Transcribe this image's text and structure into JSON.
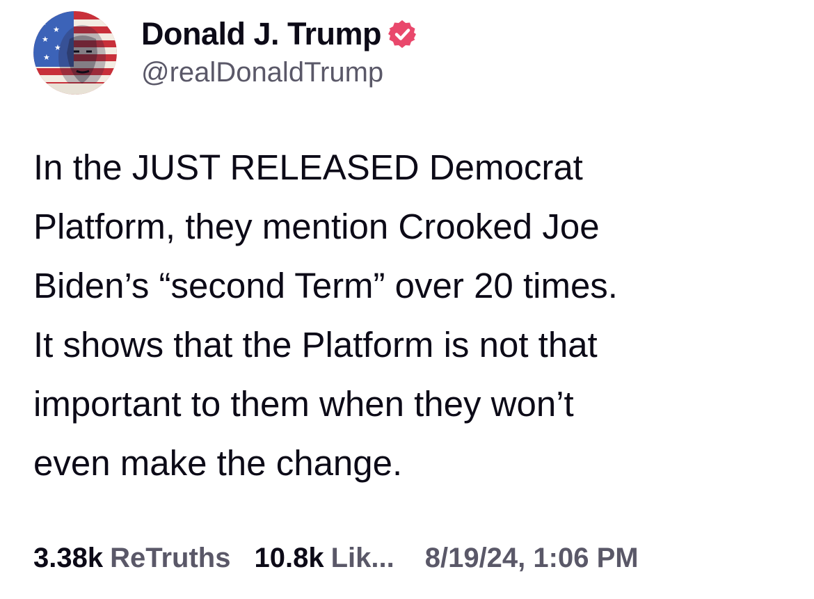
{
  "author": {
    "display_name": "Donald J. Trump",
    "handle": "@realDonaldTrump",
    "verified_icon": "verified-badge-icon",
    "accent_color": "#e9486c"
  },
  "post": {
    "lines": [
      "In the JUST RELEASED Democrat",
      "Platform, they mention Crooked Joe",
      "Biden’s “second Term” over 20 times.",
      "It shows that the Platform is not that",
      "important to them when they won’t",
      "even make the change."
    ]
  },
  "stats": {
    "retruths_count": "3.38k",
    "retruths_label": "ReTruths",
    "likes_count": "10.8k",
    "likes_label": "Lik...",
    "timestamp": "8/19/24, 1:06 PM"
  }
}
